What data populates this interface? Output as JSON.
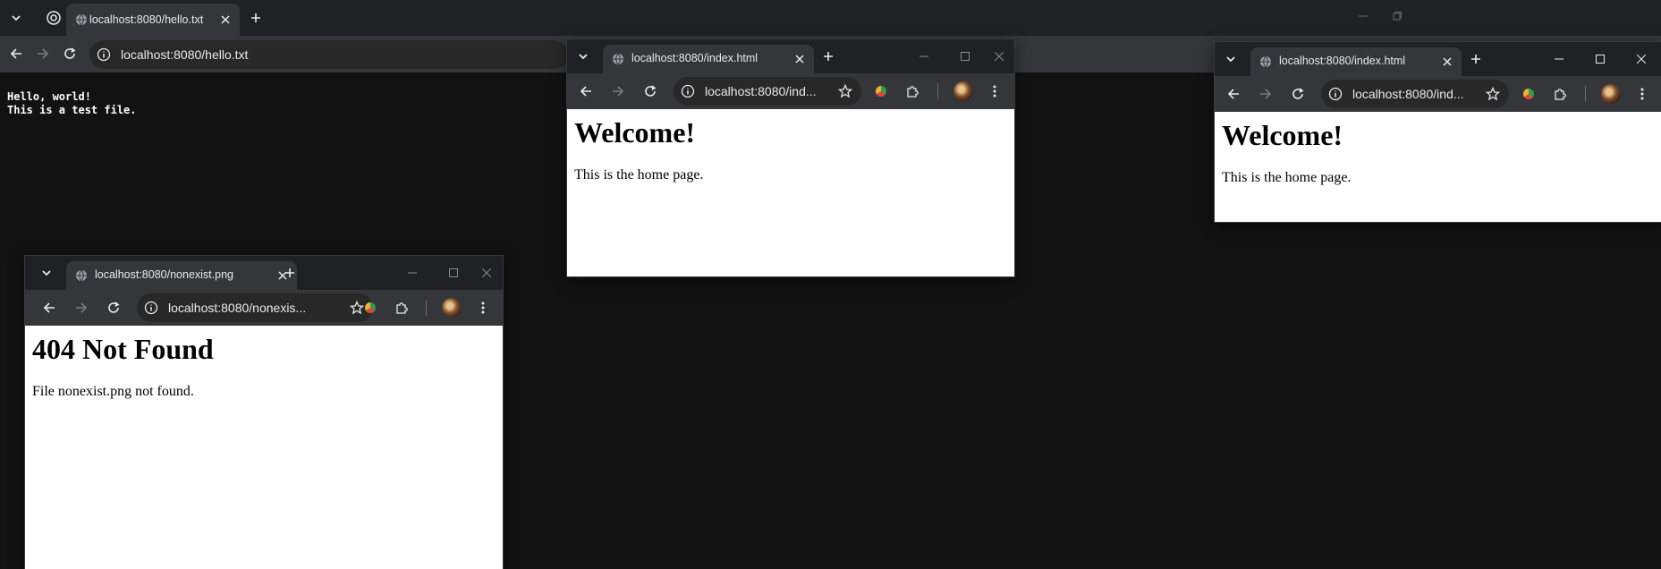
{
  "main_window": {
    "tab_title": "localhost:8080/hello.txt",
    "url": "localhost:8080/hello.txt",
    "content_lines": [
      "Hello, world!",
      "This is a test file."
    ]
  },
  "window_404": {
    "tab_title": "localhost:8080/nonexist.png",
    "url": "localhost:8080/nonexis...",
    "heading": "404 Not Found",
    "body": "File nonexist.png not found."
  },
  "window_index_middle": {
    "tab_title": "localhost:8080/index.html",
    "url": "localhost:8080/ind...",
    "heading": "Welcome!",
    "body": "This is the home page."
  },
  "window_index_right": {
    "tab_title": "localhost:8080/index.html",
    "url": "localhost:8080/ind...",
    "heading": "Welcome!",
    "body": "This is the home page."
  },
  "icons": {
    "back": "arrow-left-icon",
    "forward": "arrow-right-icon",
    "reload": "reload-icon",
    "info": "info-icon",
    "star": "star-icon",
    "extensions": "puzzle-icon",
    "menu": "three-dots-icon"
  },
  "colors": {
    "frame": "#202124",
    "toolbar": "#35363a",
    "omnibox": "#282828",
    "text_page_bg": "#121212",
    "page_bg": "#ffffff"
  }
}
